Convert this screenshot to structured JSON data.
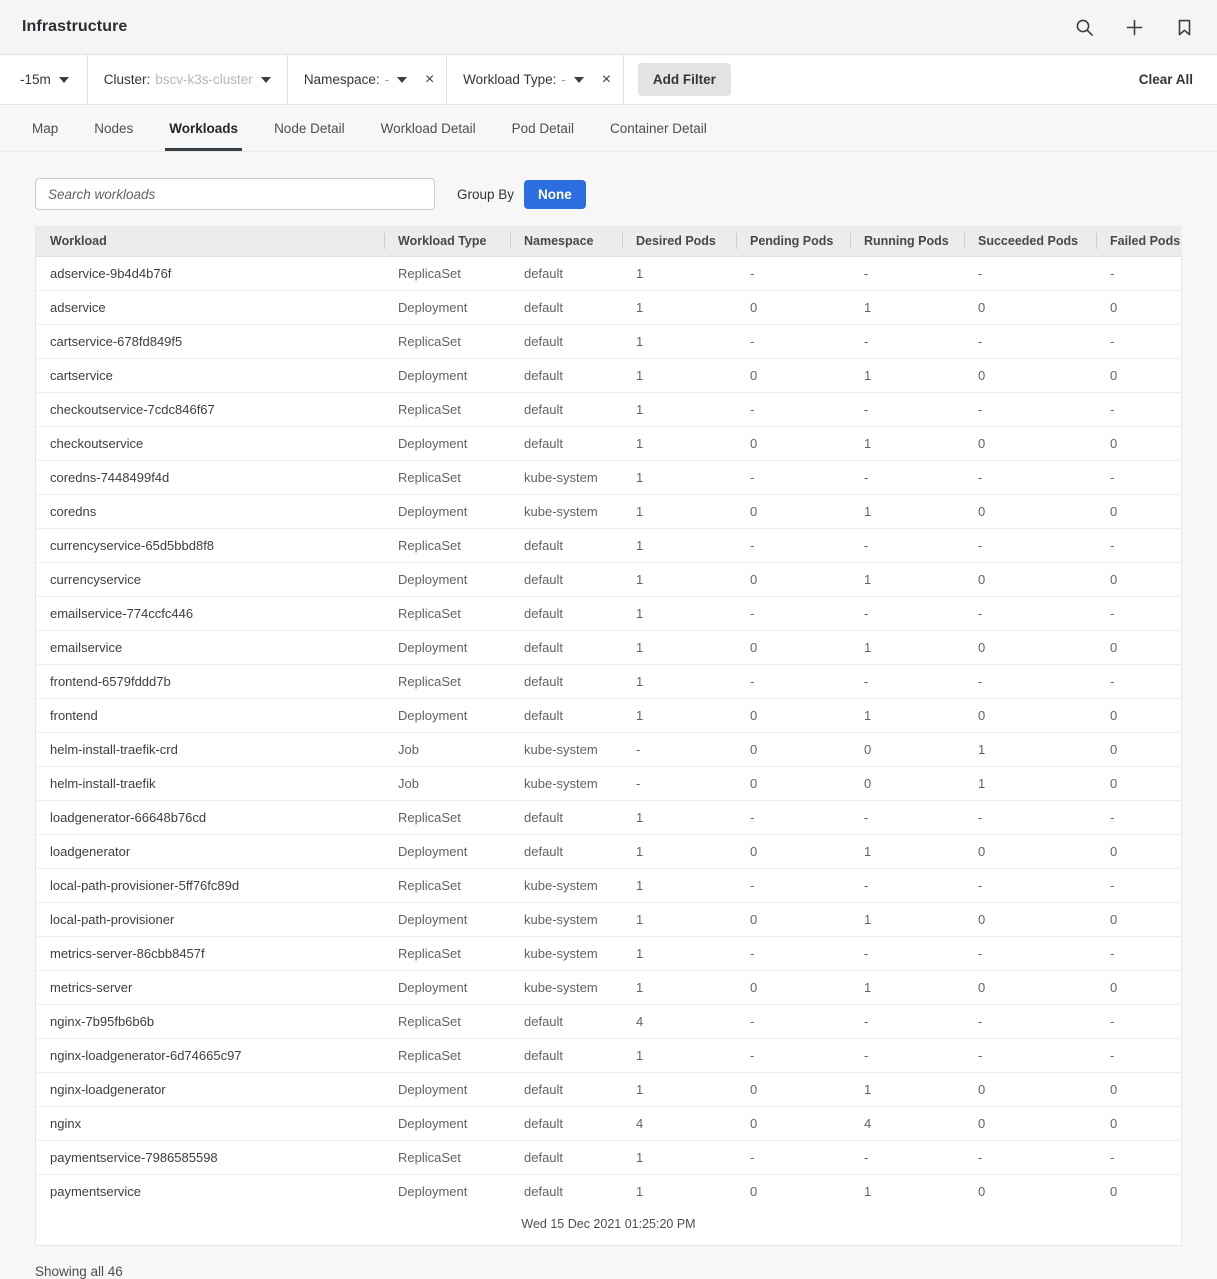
{
  "header": {
    "title": "Infrastructure",
    "icons": [
      {
        "name": "search-icon",
        "label": "Search"
      },
      {
        "name": "plus-icon",
        "label": "Add"
      },
      {
        "name": "bookmark-icon",
        "label": "Bookmark"
      }
    ]
  },
  "filterbar": {
    "time_range": "-15m",
    "filters": [
      {
        "label": "Cluster:",
        "value": "bscv-k3s-cluster",
        "removable": false
      },
      {
        "label": "Namespace:",
        "value": "-",
        "removable": true
      },
      {
        "label": "Workload Type:",
        "value": "-",
        "removable": true
      }
    ],
    "add_filter_label": "Add Filter",
    "clear_all_label": "Clear All",
    "close_label": "×"
  },
  "tabs": [
    {
      "label": "Map",
      "active": false
    },
    {
      "label": "Nodes",
      "active": false
    },
    {
      "label": "Workloads",
      "active": true
    },
    {
      "label": "Node Detail",
      "active": false
    },
    {
      "label": "Workload Detail",
      "active": false
    },
    {
      "label": "Pod Detail",
      "active": false
    },
    {
      "label": "Container Detail",
      "active": false
    }
  ],
  "toolbar": {
    "search_placeholder": "Search workloads",
    "search_value": "",
    "group_by_label": "Group By",
    "group_by_value": "None"
  },
  "table": {
    "columns": [
      "Workload",
      "Workload Type",
      "Namespace",
      "Desired Pods",
      "Pending Pods",
      "Running Pods",
      "Succeeded Pods",
      "Failed Pods"
    ],
    "rows": [
      [
        "adservice-9b4d4b76f",
        "ReplicaSet",
        "default",
        "1",
        "-",
        "-",
        "-",
        "-"
      ],
      [
        "adservice",
        "Deployment",
        "default",
        "1",
        "0",
        "1",
        "0",
        "0"
      ],
      [
        "cartservice-678fd849f5",
        "ReplicaSet",
        "default",
        "1",
        "-",
        "-",
        "-",
        "-"
      ],
      [
        "cartservice",
        "Deployment",
        "default",
        "1",
        "0",
        "1",
        "0",
        "0"
      ],
      [
        "checkoutservice-7cdc846f67",
        "ReplicaSet",
        "default",
        "1",
        "-",
        "-",
        "-",
        "-"
      ],
      [
        "checkoutservice",
        "Deployment",
        "default",
        "1",
        "0",
        "1",
        "0",
        "0"
      ],
      [
        "coredns-7448499f4d",
        "ReplicaSet",
        "kube-system",
        "1",
        "-",
        "-",
        "-",
        "-"
      ],
      [
        "coredns",
        "Deployment",
        "kube-system",
        "1",
        "0",
        "1",
        "0",
        "0"
      ],
      [
        "currencyservice-65d5bbd8f8",
        "ReplicaSet",
        "default",
        "1",
        "-",
        "-",
        "-",
        "-"
      ],
      [
        "currencyservice",
        "Deployment",
        "default",
        "1",
        "0",
        "1",
        "0",
        "0"
      ],
      [
        "emailservice-774ccfc446",
        "ReplicaSet",
        "default",
        "1",
        "-",
        "-",
        "-",
        "-"
      ],
      [
        "emailservice",
        "Deployment",
        "default",
        "1",
        "0",
        "1",
        "0",
        "0"
      ],
      [
        "frontend-6579fddd7b",
        "ReplicaSet",
        "default",
        "1",
        "-",
        "-",
        "-",
        "-"
      ],
      [
        "frontend",
        "Deployment",
        "default",
        "1",
        "0",
        "1",
        "0",
        "0"
      ],
      [
        "helm-install-traefik-crd",
        "Job",
        "kube-system",
        "-",
        "0",
        "0",
        "1",
        "0"
      ],
      [
        "helm-install-traefik",
        "Job",
        "kube-system",
        "-",
        "0",
        "0",
        "1",
        "0"
      ],
      [
        "loadgenerator-66648b76cd",
        "ReplicaSet",
        "default",
        "1",
        "-",
        "-",
        "-",
        "-"
      ],
      [
        "loadgenerator",
        "Deployment",
        "default",
        "1",
        "0",
        "1",
        "0",
        "0"
      ],
      [
        "local-path-provisioner-5ff76fc89d",
        "ReplicaSet",
        "kube-system",
        "1",
        "-",
        "-",
        "-",
        "-"
      ],
      [
        "local-path-provisioner",
        "Deployment",
        "kube-system",
        "1",
        "0",
        "1",
        "0",
        "0"
      ],
      [
        "metrics-server-86cbb8457f",
        "ReplicaSet",
        "kube-system",
        "1",
        "-",
        "-",
        "-",
        "-"
      ],
      [
        "metrics-server",
        "Deployment",
        "kube-system",
        "1",
        "0",
        "1",
        "0",
        "0"
      ],
      [
        "nginx-7b95fb6b6b",
        "ReplicaSet",
        "default",
        "4",
        "-",
        "-",
        "-",
        "-"
      ],
      [
        "nginx-loadgenerator-6d74665c97",
        "ReplicaSet",
        "default",
        "1",
        "-",
        "-",
        "-",
        "-"
      ],
      [
        "nginx-loadgenerator",
        "Deployment",
        "default",
        "1",
        "0",
        "1",
        "0",
        "0"
      ],
      [
        "nginx",
        "Deployment",
        "default",
        "4",
        "0",
        "4",
        "0",
        "0"
      ],
      [
        "paymentservice-7986585598",
        "ReplicaSet",
        "default",
        "1",
        "-",
        "-",
        "-",
        "-"
      ],
      [
        "paymentservice",
        "Deployment",
        "default",
        "1",
        "0",
        "1",
        "0",
        "0"
      ]
    ],
    "timestamp": "Wed 15 Dec 2021 01:25:20 PM"
  },
  "footer": {
    "showing": "Showing all 46"
  },
  "colors": {
    "accent_blue": "#2a6ee0",
    "titlebar_bg": "#f5f5f5",
    "table_header_bg": "#ececec",
    "page_bg": "#f7f7f7"
  }
}
